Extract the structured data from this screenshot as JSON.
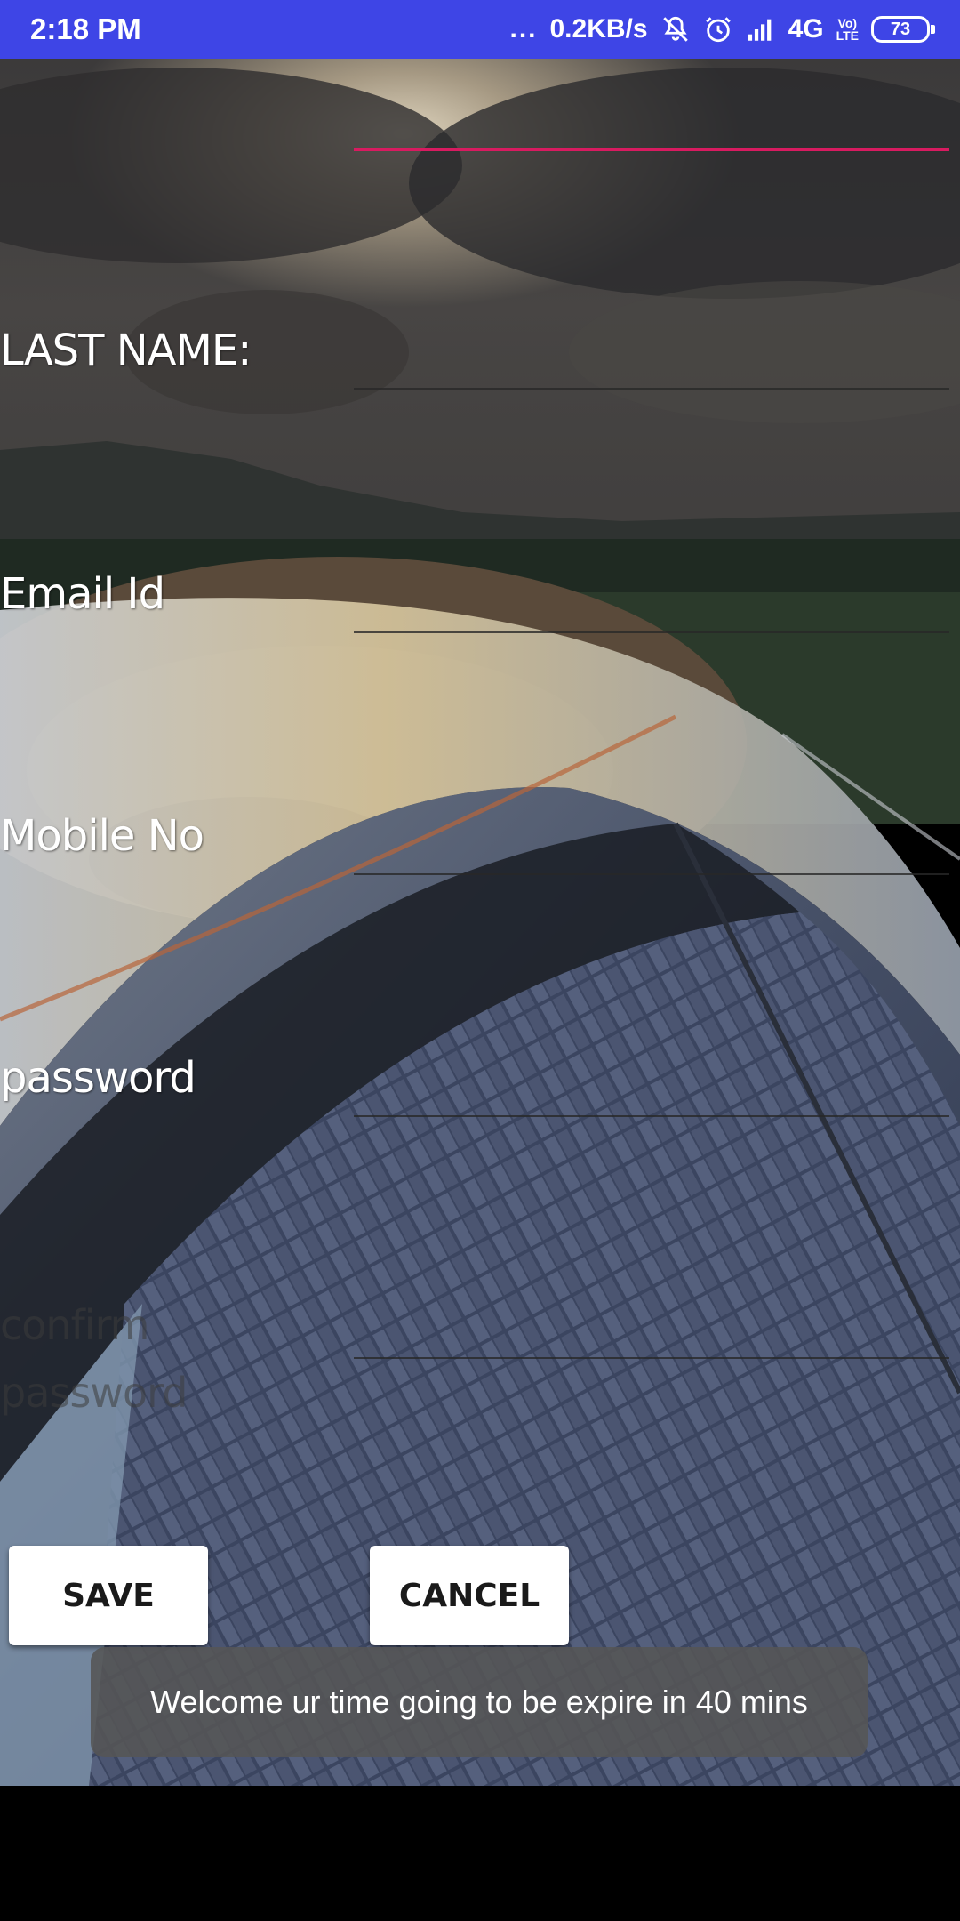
{
  "status_bar": {
    "time": "2:18 PM",
    "dots": "...",
    "net_speed": "0.2KB/s",
    "network": "4G",
    "volte_top": "Vo)",
    "volte_bottom": "LTE",
    "battery": "73",
    "icons": [
      "mute-icon",
      "alarm-icon",
      "signal-icon"
    ],
    "background_color": "#3e45e6"
  },
  "form": {
    "fields": [
      {
        "label": "",
        "value": ""
      },
      {
        "label": "LAST NAME:",
        "value": ""
      },
      {
        "label": "Email Id",
        "value": ""
      },
      {
        "label": "Mobile No",
        "value": ""
      },
      {
        "label": "password",
        "value": ""
      },
      {
        "label": "confirm\npassword",
        "value": ""
      }
    ],
    "accent_color": "#d81b60"
  },
  "buttons": {
    "save": "SAVE",
    "cancel": "CANCEL"
  },
  "toast": {
    "message": "Welcome ur time going to be expire in 40 mins"
  }
}
